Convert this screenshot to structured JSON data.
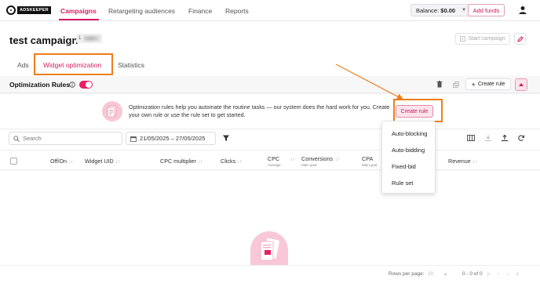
{
  "nav": {
    "logo_text": "ADSKEEPER",
    "links": [
      "Campaigns",
      "Retargeting audiences",
      "Finance",
      "Reports"
    ],
    "balance_label": "Balance:",
    "balance_value": "$0.00",
    "add_funds": "Add funds"
  },
  "campaign": {
    "title": "test campaign",
    "id_prefix": "1",
    "start_label": "Start campaign",
    "tabs": [
      "Ads",
      "Widget optimization",
      "Statistics"
    ]
  },
  "rules": {
    "title": "Optimization Rules",
    "create_rule_label": "Create rule",
    "toggle_on": true
  },
  "banner": {
    "text": "Optimization rules help you automate the routine tasks — our system does the hard work for you. Create your own rule or use the rule set to get started.",
    "create_rule_label": "Create rule"
  },
  "filters": {
    "search_placeholder": "Search",
    "date_range": "21/05/2025 – 27/05/2025"
  },
  "table": {
    "columns": [
      {
        "label": "Off/On",
        "sub": ""
      },
      {
        "label": "Widget UID",
        "sub": ""
      },
      {
        "label": "CPC multiplier",
        "sub": ""
      },
      {
        "label": "Clicks",
        "sub": ""
      },
      {
        "label": "CPC",
        "sub": "Average"
      },
      {
        "label": "Conversions",
        "sub": "Main goal"
      },
      {
        "label": "CPA",
        "sub": "Main goal"
      },
      {
        "label": "Revenue",
        "sub": ""
      }
    ]
  },
  "dropdown": {
    "items": [
      "Auto-blocking",
      "Auto-bidding",
      "Fixed-bid",
      "Rule set"
    ]
  },
  "pagination": {
    "rows_label": "Rows per page:",
    "rows_value": "20",
    "range": "0 - 0 of 0"
  },
  "colors": {
    "accent": "#d81b60",
    "highlight": "#ef7d1a"
  },
  "icons": [
    "user-icon",
    "info-icon",
    "trash-icon",
    "copy-icon",
    "plus-icon",
    "chevron-up-icon",
    "search-icon",
    "calendar-icon",
    "filter-icon",
    "columns-icon",
    "download-icon",
    "upload-icon",
    "refresh-icon",
    "pencil-icon",
    "play-icon"
  ]
}
